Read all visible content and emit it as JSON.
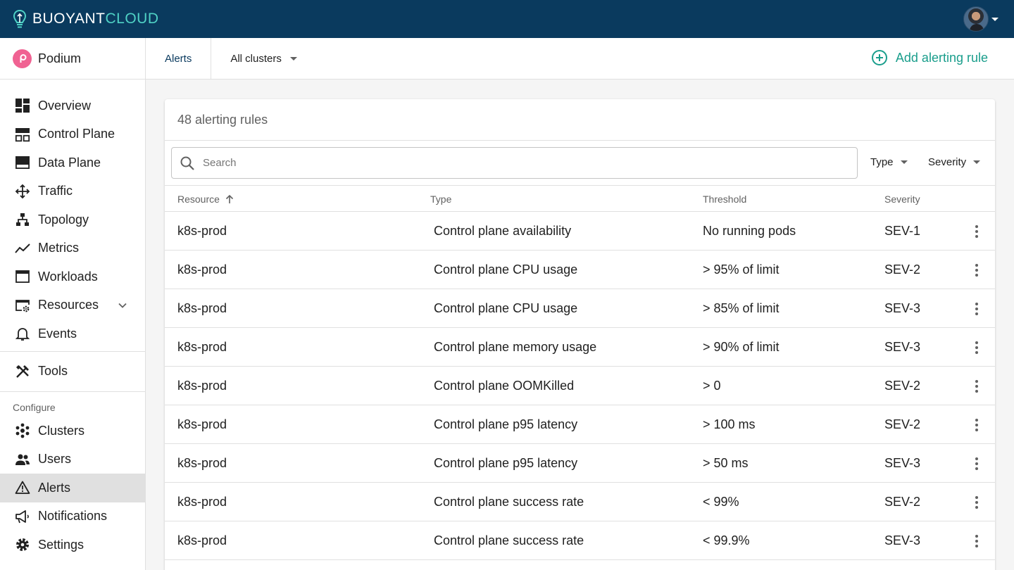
{
  "topbar": {
    "brand_part1": "BUOYANT",
    "brand_part2": "CLOUD"
  },
  "sidebar": {
    "org_name": "Podium",
    "primary": [
      {
        "label": "Overview",
        "icon": "dashboard-icon"
      },
      {
        "label": "Control Plane",
        "icon": "control-plane-icon"
      },
      {
        "label": "Data Plane",
        "icon": "data-plane-icon"
      },
      {
        "label": "Traffic",
        "icon": "traffic-arrows-icon"
      },
      {
        "label": "Topology",
        "icon": "topology-icon"
      },
      {
        "label": "Metrics",
        "icon": "metrics-line-icon"
      },
      {
        "label": "Workloads",
        "icon": "workloads-window-icon"
      },
      {
        "label": "Resources",
        "icon": "resources-settings-icon"
      },
      {
        "label": "Events",
        "icon": "bell-icon"
      }
    ],
    "tools": {
      "label": "Tools",
      "icon": "tools-icon"
    },
    "configure_label": "Configure",
    "configure": [
      {
        "label": "Clusters",
        "icon": "clusters-icon"
      },
      {
        "label": "Users",
        "icon": "users-icon"
      },
      {
        "label": "Alerts",
        "icon": "warning-triangle-icon",
        "active": true
      },
      {
        "label": "Notifications",
        "icon": "megaphone-icon"
      },
      {
        "label": "Settings",
        "icon": "gear-icon"
      }
    ]
  },
  "subheader": {
    "breadcrumb": "Alerts",
    "cluster_select": "All clusters",
    "add_rule": "Add alerting rule"
  },
  "card": {
    "title": "48 alerting rules",
    "search_placeholder": "Search",
    "filter_type": "Type",
    "filter_severity": "Severity",
    "columns": {
      "resource": "Resource",
      "type": "Type",
      "threshold": "Threshold",
      "severity": "Severity"
    },
    "rows": [
      {
        "resource": "k8s-prod",
        "type": "Control plane availability",
        "threshold": "No running pods",
        "severity": "SEV-1"
      },
      {
        "resource": "k8s-prod",
        "type": "Control plane CPU usage",
        "threshold": "> 95% of limit",
        "severity": "SEV-2"
      },
      {
        "resource": "k8s-prod",
        "type": "Control plane CPU usage",
        "threshold": "> 85% of limit",
        "severity": "SEV-3"
      },
      {
        "resource": "k8s-prod",
        "type": "Control plane memory usage",
        "threshold": "> 90% of limit",
        "severity": "SEV-3"
      },
      {
        "resource": "k8s-prod",
        "type": "Control plane OOMKilled",
        "threshold": "> 0",
        "severity": "SEV-2"
      },
      {
        "resource": "k8s-prod",
        "type": "Control plane p95 latency",
        "threshold": "> 100 ms",
        "severity": "SEV-2"
      },
      {
        "resource": "k8s-prod",
        "type": "Control plane p95 latency",
        "threshold": "> 50 ms",
        "severity": "SEV-3"
      },
      {
        "resource": "k8s-prod",
        "type": "Control plane success rate",
        "threshold": "< 99%",
        "severity": "SEV-2"
      },
      {
        "resource": "k8s-prod",
        "type": "Control plane success rate",
        "threshold": "< 99.9%",
        "severity": "SEV-3"
      }
    ]
  },
  "colors": {
    "topbar": "#0a3a5e",
    "accent": "#1a9e8c",
    "brand_cloud": "#4fd1c5",
    "org_logo": "#f06292"
  }
}
